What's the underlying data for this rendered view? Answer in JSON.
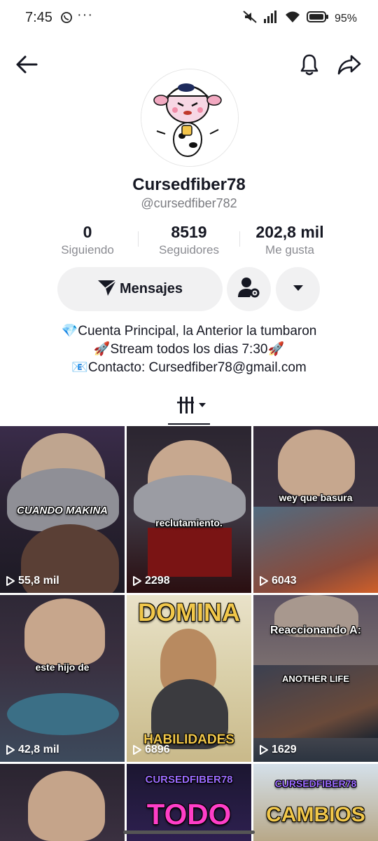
{
  "status": {
    "time": "7:45",
    "dots": "···",
    "battery": "95%"
  },
  "profile": {
    "display_name": "Cursedfiber78",
    "username": "@cursedfiber782"
  },
  "stats": [
    {
      "value": "0",
      "label": "Siguiendo"
    },
    {
      "value": "8519",
      "label": "Seguidores"
    },
    {
      "value": "202,8 mil",
      "label": "Me gusta"
    }
  ],
  "actions": {
    "message_label": "Mensajes"
  },
  "bio": [
    "💎Cuenta Principal, la Anterior la tumbaron",
    "🚀Stream todos los dias 7:30🚀",
    "📧Contacto: Cursedfiber78@gmail.com"
  ],
  "videos": [
    {
      "views": "55,8 mil",
      "caption": "CUANDO MAKINA"
    },
    {
      "views": "2298",
      "caption": "reclutamiento."
    },
    {
      "views": "6043",
      "caption": "wey que basura"
    },
    {
      "views": "42,8 mil",
      "caption": "este hijo de"
    },
    {
      "views": "6896",
      "caption": "DOMINA",
      "caption2": "HABILIDADES"
    },
    {
      "views": "1629",
      "caption": "Reaccionando A:",
      "caption2": "ANOTHER LIFE"
    },
    {
      "views": "",
      "caption": ""
    },
    {
      "views": "",
      "caption": "CURSEDFIBER78",
      "caption2": "TODO"
    },
    {
      "views": "",
      "caption": "CURSEDFIBER78",
      "caption2": "CAMBIOS"
    }
  ]
}
